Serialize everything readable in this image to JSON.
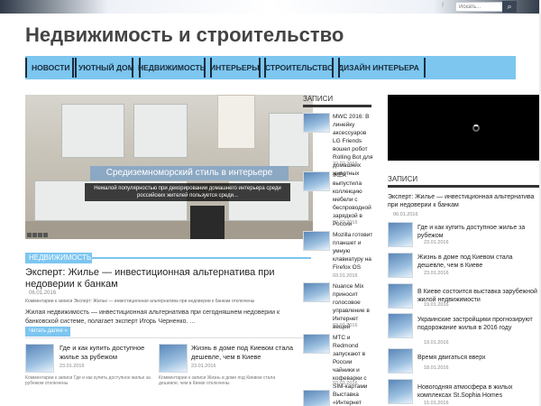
{
  "header": {
    "search_placeholder": "Искать...",
    "site_title": "Недвижимость и строительство"
  },
  "nav": {
    "items": [
      "НОВОСТИ",
      "УЮТНЫЙ ДОМ",
      "НЕДВИЖИМОСТЬ",
      "ИНТЕРЬЕРЫ",
      "СТРОИТЕЛЬСТВО",
      "ДИЗАЙН ИНТЕРЬЕРА"
    ]
  },
  "slider": {
    "caption": "Средиземноморский стиль в интерьере",
    "description": "Немалой популярностью при декорировании домашнего интерьера среди российских жителей пользуется среди..."
  },
  "featured": {
    "category": "НЕДВИЖИМОСТЬ",
    "title": "Эксперт: Жилье — инвестиционная альтернатива при недоверии к банкам",
    "date": "06.01.2016",
    "meta": "Комментарии к записи Эксперт: Жилье — инвестиционная альтернатива при недоверии к банкам отключены",
    "excerpt": "Жилая недвижимость — инвестиционная альтернатива при сегодняшнем недоверии к банковской системе, полагает эксперт Игорь Черненко. ...",
    "read_more": "Читать далее »"
  },
  "bottom_posts": [
    {
      "title": "Где и как купить доступное жилье за рубежом",
      "date": "23.01.2016",
      "meta": "Комментарии к записи Где и как купить доступное жилье за рубежом отключены"
    },
    {
      "title": "Жизнь в доме под Киевом стала дешевле, чем в Киеве",
      "date": "23.01.2016",
      "meta": "Комментарии к записи Жизнь в доме под Киевом стала дешевле, чем в Киеве отключены"
    }
  ],
  "col2": {
    "heading": "ЗАПИСИ",
    "posts": [
      {
        "title": "MWC 2016: В линейку аксессуаров LG Friends вошел робот Rolling Bot для домашних животных",
        "date": "22.02.2016"
      },
      {
        "title": "IKEA выпустила коллекцию мебели с беспроводной зарядкой в России",
        "date": "02.02.2016"
      },
      {
        "title": "Mozilla готовит планшет и умную клавиатуру на Firefox OS",
        "date": "03.01.2016"
      },
      {
        "title": "Nuance Mix приносит голосовое управление в Интернет вещей",
        "date": "03.01.2016"
      },
      {
        "title": "МТС и Redmond запускают в России чайники и кофеварки с SIM-картами",
        "date": "03.01.2016"
      },
      {
        "title": "Выставка «Интернет",
        "date": ""
      }
    ]
  },
  "col3": {
    "heading": "ЗАПИСИ",
    "top_title": "Эксперт: Жилье — инвестиционная альтернатива при недоверии к банкам",
    "top_date": "06.01.2016",
    "posts": [
      {
        "title": "Где и как купить доступное жилье за рубежом",
        "date": "23.01.2016"
      },
      {
        "title": "Жизнь в доме под Киевом стала дешевле, чем в Киеве",
        "date": "23.01.2016"
      },
      {
        "title": "В Киеве состоится выставка зарубежной жилой недвижимости",
        "date": "19.01.2016"
      },
      {
        "title": "Украинские застройщики прогнозируют подорожание жилья в 2016 году",
        "date": "19.01.2016"
      },
      {
        "title": "Время двигаться вверх",
        "date": "18.01.2016"
      },
      {
        "title": "Новогодняя атмосфера в жилых комплексах St.Sophia Homes",
        "date": "15.01.2016"
      }
    ]
  }
}
